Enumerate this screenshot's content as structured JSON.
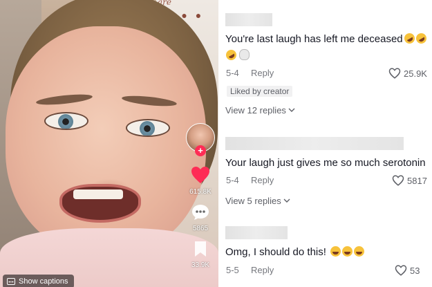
{
  "video": {
    "poster_text": "are",
    "rail": {
      "avatar_icon": "creator-avatar",
      "likes_count": "615.8K",
      "comments_count": "5865",
      "bookmarks_count": "33.9K"
    },
    "captions_label": "Show captions"
  },
  "comments": [
    {
      "text": "You're last laugh has left me deceased",
      "emoji_line2": true,
      "date": "5-4",
      "reply_label": "Reply",
      "likes": "25.9K",
      "badge": "Liked by creator",
      "view_replies": "View 12 replies"
    },
    {
      "text": "Your laugh just gives me so much serotonin",
      "date": "5-4",
      "reply_label": "Reply",
      "likes": "5817",
      "view_replies": "View 5 replies"
    },
    {
      "text": "Omg, I should do this!",
      "date": "5-5",
      "reply_label": "Reply",
      "likes": "53"
    }
  ],
  "colors": {
    "like_red": "#fe2c55",
    "text_primary": "#161823",
    "text_muted": "#75777d"
  }
}
